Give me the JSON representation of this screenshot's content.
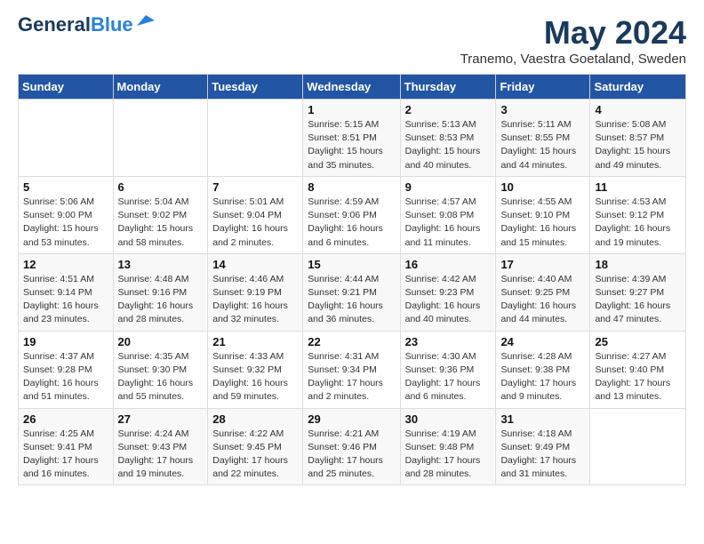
{
  "header": {
    "logo_line1": "General",
    "logo_line2": "Blue",
    "month_title": "May 2024",
    "subtitle": "Tranemo, Vaestra Goetaland, Sweden"
  },
  "days_of_week": [
    "Sunday",
    "Monday",
    "Tuesday",
    "Wednesday",
    "Thursday",
    "Friday",
    "Saturday"
  ],
  "weeks": [
    [
      {
        "day": "",
        "info": ""
      },
      {
        "day": "",
        "info": ""
      },
      {
        "day": "",
        "info": ""
      },
      {
        "day": "1",
        "info": "Sunrise: 5:15 AM\nSunset: 8:51 PM\nDaylight: 15 hours and 35 minutes."
      },
      {
        "day": "2",
        "info": "Sunrise: 5:13 AM\nSunset: 8:53 PM\nDaylight: 15 hours and 40 minutes."
      },
      {
        "day": "3",
        "info": "Sunrise: 5:11 AM\nSunset: 8:55 PM\nDaylight: 15 hours and 44 minutes."
      },
      {
        "day": "4",
        "info": "Sunrise: 5:08 AM\nSunset: 8:57 PM\nDaylight: 15 hours and 49 minutes."
      }
    ],
    [
      {
        "day": "5",
        "info": "Sunrise: 5:06 AM\nSunset: 9:00 PM\nDaylight: 15 hours and 53 minutes."
      },
      {
        "day": "6",
        "info": "Sunrise: 5:04 AM\nSunset: 9:02 PM\nDaylight: 15 hours and 58 minutes."
      },
      {
        "day": "7",
        "info": "Sunrise: 5:01 AM\nSunset: 9:04 PM\nDaylight: 16 hours and 2 minutes."
      },
      {
        "day": "8",
        "info": "Sunrise: 4:59 AM\nSunset: 9:06 PM\nDaylight: 16 hours and 6 minutes."
      },
      {
        "day": "9",
        "info": "Sunrise: 4:57 AM\nSunset: 9:08 PM\nDaylight: 16 hours and 11 minutes."
      },
      {
        "day": "10",
        "info": "Sunrise: 4:55 AM\nSunset: 9:10 PM\nDaylight: 16 hours and 15 minutes."
      },
      {
        "day": "11",
        "info": "Sunrise: 4:53 AM\nSunset: 9:12 PM\nDaylight: 16 hours and 19 minutes."
      }
    ],
    [
      {
        "day": "12",
        "info": "Sunrise: 4:51 AM\nSunset: 9:14 PM\nDaylight: 16 hours and 23 minutes."
      },
      {
        "day": "13",
        "info": "Sunrise: 4:48 AM\nSunset: 9:16 PM\nDaylight: 16 hours and 28 minutes."
      },
      {
        "day": "14",
        "info": "Sunrise: 4:46 AM\nSunset: 9:19 PM\nDaylight: 16 hours and 32 minutes."
      },
      {
        "day": "15",
        "info": "Sunrise: 4:44 AM\nSunset: 9:21 PM\nDaylight: 16 hours and 36 minutes."
      },
      {
        "day": "16",
        "info": "Sunrise: 4:42 AM\nSunset: 9:23 PM\nDaylight: 16 hours and 40 minutes."
      },
      {
        "day": "17",
        "info": "Sunrise: 4:40 AM\nSunset: 9:25 PM\nDaylight: 16 hours and 44 minutes."
      },
      {
        "day": "18",
        "info": "Sunrise: 4:39 AM\nSunset: 9:27 PM\nDaylight: 16 hours and 47 minutes."
      }
    ],
    [
      {
        "day": "19",
        "info": "Sunrise: 4:37 AM\nSunset: 9:28 PM\nDaylight: 16 hours and 51 minutes."
      },
      {
        "day": "20",
        "info": "Sunrise: 4:35 AM\nSunset: 9:30 PM\nDaylight: 16 hours and 55 minutes."
      },
      {
        "day": "21",
        "info": "Sunrise: 4:33 AM\nSunset: 9:32 PM\nDaylight: 16 hours and 59 minutes."
      },
      {
        "day": "22",
        "info": "Sunrise: 4:31 AM\nSunset: 9:34 PM\nDaylight: 17 hours and 2 minutes."
      },
      {
        "day": "23",
        "info": "Sunrise: 4:30 AM\nSunset: 9:36 PM\nDaylight: 17 hours and 6 minutes."
      },
      {
        "day": "24",
        "info": "Sunrise: 4:28 AM\nSunset: 9:38 PM\nDaylight: 17 hours and 9 minutes."
      },
      {
        "day": "25",
        "info": "Sunrise: 4:27 AM\nSunset: 9:40 PM\nDaylight: 17 hours and 13 minutes."
      }
    ],
    [
      {
        "day": "26",
        "info": "Sunrise: 4:25 AM\nSunset: 9:41 PM\nDaylight: 17 hours and 16 minutes."
      },
      {
        "day": "27",
        "info": "Sunrise: 4:24 AM\nSunset: 9:43 PM\nDaylight: 17 hours and 19 minutes."
      },
      {
        "day": "28",
        "info": "Sunrise: 4:22 AM\nSunset: 9:45 PM\nDaylight: 17 hours and 22 minutes."
      },
      {
        "day": "29",
        "info": "Sunrise: 4:21 AM\nSunset: 9:46 PM\nDaylight: 17 hours and 25 minutes."
      },
      {
        "day": "30",
        "info": "Sunrise: 4:19 AM\nSunset: 9:48 PM\nDaylight: 17 hours and 28 minutes."
      },
      {
        "day": "31",
        "info": "Sunrise: 4:18 AM\nSunset: 9:49 PM\nDaylight: 17 hours and 31 minutes."
      },
      {
        "day": "",
        "info": ""
      }
    ]
  ]
}
